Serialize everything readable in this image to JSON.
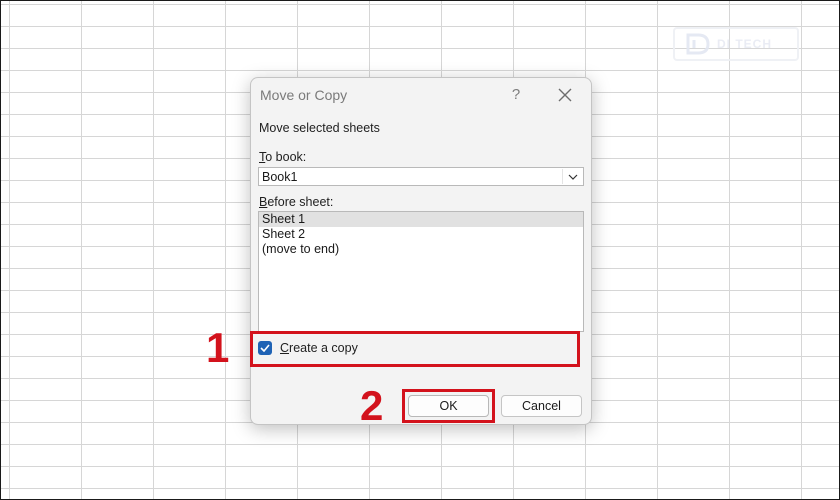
{
  "watermark": {
    "text": "DI TECH"
  },
  "dialog": {
    "title": "Move or Copy",
    "help": "?",
    "instruction": "Move selected sheets",
    "to_book": {
      "label_key": "T",
      "label_rest": "o book:",
      "value": "Book1"
    },
    "before_sheet": {
      "label_key": "B",
      "label_rest": "efore sheet:",
      "items": [
        "Sheet 1",
        "Sheet 2",
        "(move to end)"
      ],
      "selected": "Sheet 1"
    },
    "create_copy": {
      "label_key": "C",
      "label_rest": "reate a copy",
      "checked": true
    },
    "buttons": {
      "ok": "OK",
      "cancel": "Cancel"
    }
  },
  "annotations": {
    "step1": "1",
    "step2": "2",
    "color": "#d3121c"
  }
}
